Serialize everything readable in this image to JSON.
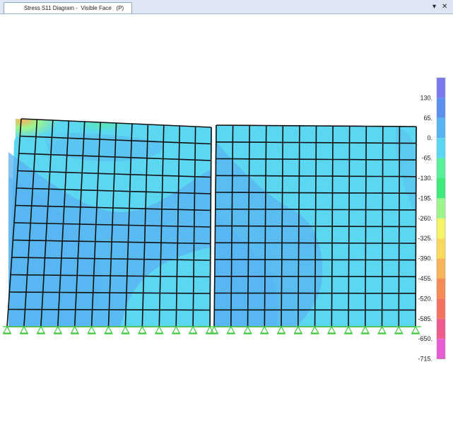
{
  "window": {
    "tab_title": "Stress S11 Diagram -  Visible Face   (P)",
    "dropdown_icon": "chevron-down-icon",
    "close_icon": "close-icon"
  },
  "legend": {
    "colors": [
      "#7a78ef",
      "#5a91ef",
      "#58b2f2",
      "#5cd7f2",
      "#58ef9b",
      "#3fea78",
      "#9cf58d",
      "#f4f564",
      "#f9d95c",
      "#f7b35a",
      "#f58c58",
      "#f27460",
      "#ed5c8a",
      "#e65dd2"
    ],
    "labels": [
      "130.",
      "65.",
      "0.",
      "-65.",
      "-130.",
      "-195.",
      "-260.",
      "-325.",
      "-390.",
      "-455.",
      "-520.",
      "-585.",
      "-650.",
      "-715."
    ]
  },
  "diagram": {
    "panels": 2,
    "supports": "pinned",
    "mesh_rows": 12,
    "left_panel_columns": 12,
    "right_panel_columns": 12
  }
}
